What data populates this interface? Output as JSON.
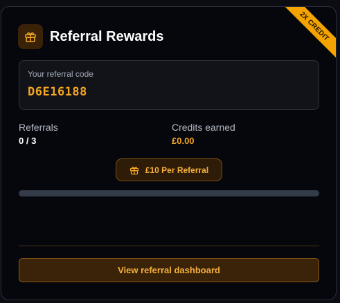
{
  "card": {
    "title": "Referral Rewards",
    "ribbon_label": "2X CREDIT",
    "header_icon": "gift-icon",
    "accent_color": "#f5a623"
  },
  "code": {
    "label": "Your referral code",
    "value": "D6E16188"
  },
  "stats": {
    "referrals_label": "Referrals",
    "referrals_value": "0 / 3",
    "credits_label": "Credits earned",
    "credits_value": "£0.00"
  },
  "pill": {
    "label": "£10 Per Referral",
    "icon": "gift-icon"
  },
  "progress": {
    "fraction": 0
  },
  "actions": {
    "dashboard_label": "View referral dashboard"
  }
}
